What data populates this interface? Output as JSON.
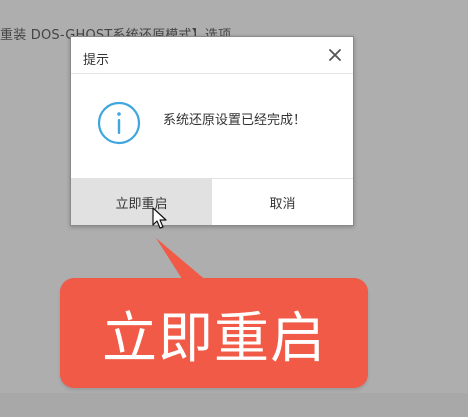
{
  "background": {
    "text": "重装 DOS-GHOST系统还原模式】选项"
  },
  "dialog": {
    "title": "提示",
    "message": "系统还原设置已经完成！",
    "buttons": {
      "restart_label": "立即重启",
      "cancel_label": "取消"
    },
    "icons": {
      "info": "info-icon",
      "close": "close-icon"
    }
  },
  "callout": {
    "text": "立即重启",
    "color": "#f05a46"
  },
  "colors": {
    "accent_blue": "#3fa6df",
    "active_button": "#e1e1e1"
  }
}
